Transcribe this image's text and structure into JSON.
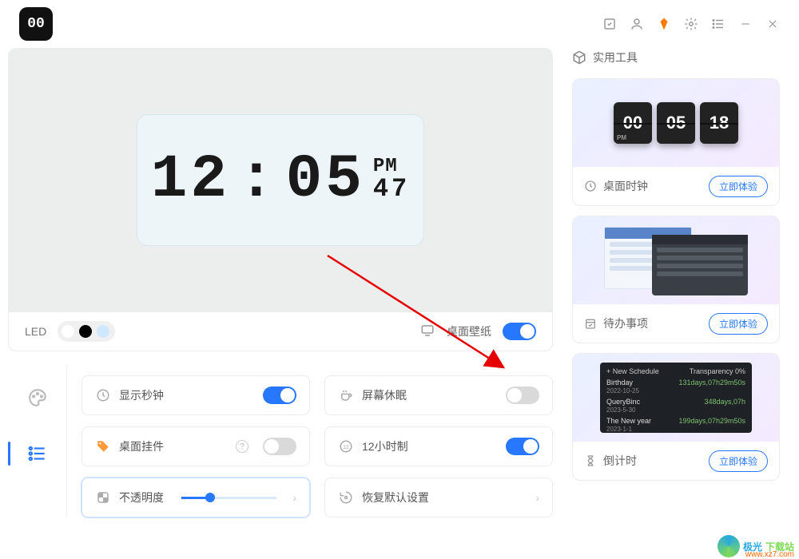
{
  "titlebar": {
    "logo_text": "00"
  },
  "preview": {
    "hours": "12",
    "minutes": "05",
    "ampm": "PM",
    "seconds": "47",
    "led_label": "LED",
    "wallpaper_label": "桌面壁纸",
    "wallpaper_on": true
  },
  "settings": {
    "show_seconds": {
      "label": "显示秒钟",
      "on": true
    },
    "screen_saver": {
      "label": "屏幕休眠",
      "on": false
    },
    "desktop_widget": {
      "label": "桌面挂件",
      "on": false
    },
    "twelve_hour": {
      "label": "12小时制",
      "on": true
    },
    "opacity": {
      "label": "不透明度"
    },
    "reset": {
      "label": "恢复默认设置"
    }
  },
  "sidebar_right": {
    "title": "实用工具",
    "clock": {
      "flip": [
        "00",
        "05",
        "18"
      ],
      "pm": "PM",
      "label": "桌面时钟",
      "btn": "立即体验"
    },
    "todo": {
      "label": "待办事项",
      "btn": "立即体验"
    },
    "countdown": {
      "header": "+ New Schedule",
      "transp": "Transparency  0%",
      "rows": [
        {
          "title": "Birthday",
          "date": "2022-10-25",
          "val": "131days,07h29m50s"
        },
        {
          "title": "QueryBinc",
          "date": "2023-5-30",
          "val": "348days,07h"
        },
        {
          "title": "The New year",
          "date": "2023-1-1",
          "val": "199days,07h29m50s"
        }
      ],
      "label": "倒计时",
      "btn": "立即体验"
    }
  },
  "watermark": {
    "name1": "极光",
    "name2": "下载站",
    "url": "www.xz7.com"
  }
}
